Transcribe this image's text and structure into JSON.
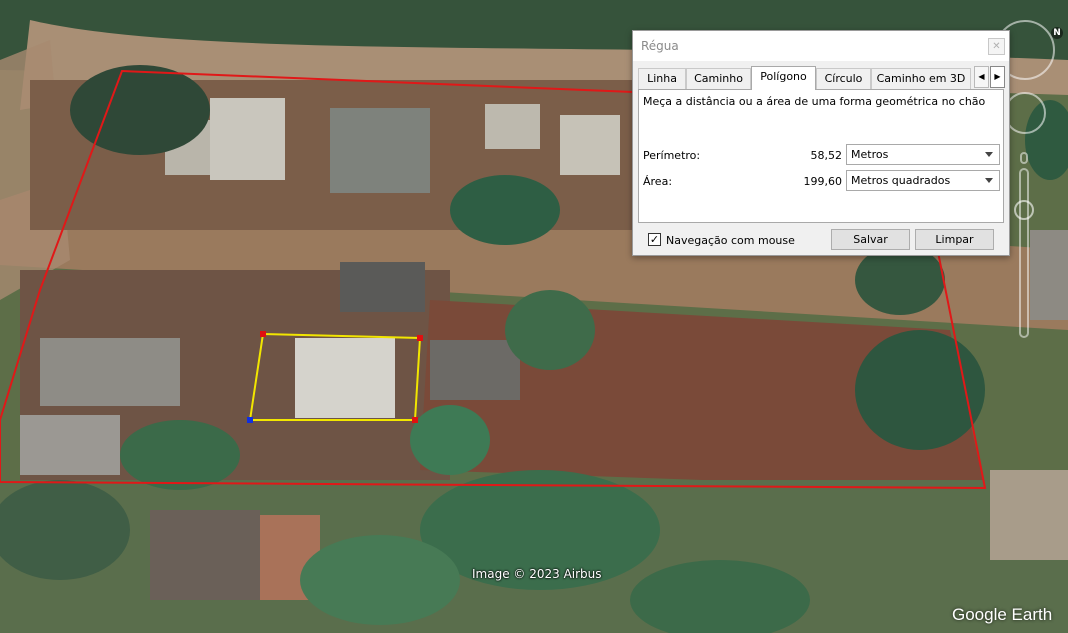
{
  "map": {
    "credit": "Image © 2023 Airbus",
    "logo": "Google Earth",
    "compass_letter": "N",
    "colors": {
      "property_outline": "#e01818",
      "measure_polygon": "#f2e600",
      "vertex_red": "#e01010",
      "vertex_blue": "#1030e0"
    }
  },
  "dialog": {
    "title": "Régua",
    "close_icon": "close-icon",
    "tabs": [
      {
        "label": "Linha",
        "active": false
      },
      {
        "label": "Caminho",
        "active": false
      },
      {
        "label": "Polígono",
        "active": true
      },
      {
        "label": "Círculo",
        "active": false
      },
      {
        "label": "Caminho em 3D",
        "active": false
      }
    ],
    "description": "Meça a distância ou a área de uma forma geométrica no chão",
    "perimeter": {
      "label": "Perímetro:",
      "value": "58,52",
      "unit": "Metros"
    },
    "area": {
      "label": "Área:",
      "value": "199,60",
      "unit": "Metros quadrados"
    },
    "mouse_navigation": {
      "label": "Navegação com mouse",
      "checked": true
    },
    "buttons": {
      "save": "Salvar",
      "clear": "Limpar"
    }
  }
}
